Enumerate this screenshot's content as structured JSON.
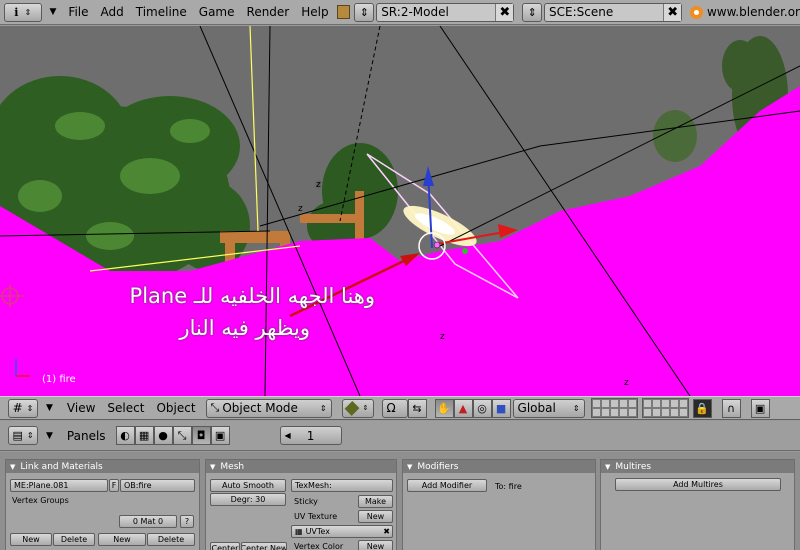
{
  "top_menu": {
    "items": [
      "File",
      "Add",
      "Timeline",
      "Game",
      "Render",
      "Help"
    ],
    "screen_field": "SR:2-Model",
    "scene_field": "SCE:Scene",
    "url_text": "www.blender.or"
  },
  "viewport": {
    "frame_label": "(1) fire",
    "overlay_line1": "وهنا الجهه الخلفيه للـ Plane",
    "overlay_line2": "ويظهر فيه النار",
    "axis_labels": [
      "z",
      "z",
      "z",
      "z"
    ],
    "colors": {
      "ground": "#ff00ff",
      "sky": "#6f6f6f",
      "foliage": "#2f6a22",
      "wood": "#c17a3a"
    }
  },
  "view3d_header": {
    "menus": [
      "View",
      "Select",
      "Object"
    ],
    "mode": "Object Mode",
    "orientation": "Global"
  },
  "buttons_header": {
    "panels_label": "Panels",
    "frame": "1"
  },
  "panels": {
    "link_materials": {
      "title": "Link and Materials",
      "mesh_name": "ME:Plane.081",
      "f_label": "F",
      "object_name": "OB:fire",
      "vertex_groups": "Vertex Groups",
      "mat_field": "0 Mat 0",
      "question": "?",
      "new1": "New",
      "delete1": "Delete",
      "new2": "New",
      "delete2": "Delete"
    },
    "mesh": {
      "title": "Mesh",
      "auto_smooth": "Auto Smooth",
      "degr": "Degr: 30",
      "texmesh": "TexMesh:",
      "sticky": "Sticky",
      "make": "Make",
      "uv_texture": "UV Texture",
      "new_uv": "New",
      "uvtex": "UVTex",
      "vertex_color": "Vertex Color",
      "new_vc": "New",
      "center": "Center",
      "center_new": "Center New"
    },
    "modifiers": {
      "title": "Modifiers",
      "add_modifier": "Add Modifier",
      "to_label": "To: fire"
    },
    "multires": {
      "title": "Multires",
      "add_multires": "Add Multires"
    }
  }
}
